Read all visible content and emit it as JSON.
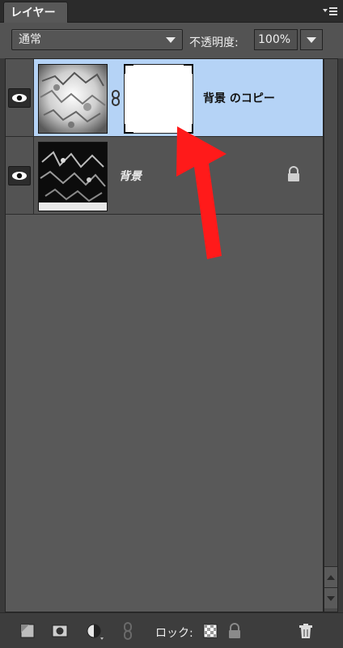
{
  "panel": {
    "tab_title": "レイヤー",
    "menu_icon": "panel-menu-icon"
  },
  "controls": {
    "blend_mode": "通常",
    "opacity_label": "不透明度:",
    "opacity_value": "100%"
  },
  "layers": [
    {
      "name": "背景 のコピー",
      "selected": true,
      "visible": true,
      "has_mask": true,
      "linked": true,
      "locked": false
    },
    {
      "name": "背景",
      "selected": false,
      "visible": true,
      "has_mask": false,
      "linked": false,
      "locked": true
    }
  ],
  "footer": {
    "lock_label": "ロック:",
    "icons": [
      "new-layer-icon",
      "add-mask-icon",
      "adjustment-layer-icon",
      "link-layers-icon",
      "lock-transparency-icon",
      "lock-all-icon",
      "trash-icon"
    ]
  },
  "colors": {
    "selected_row": "#b5d3f6",
    "panel_bg": "#595959",
    "annotation_arrow": "#ff1a1a"
  }
}
